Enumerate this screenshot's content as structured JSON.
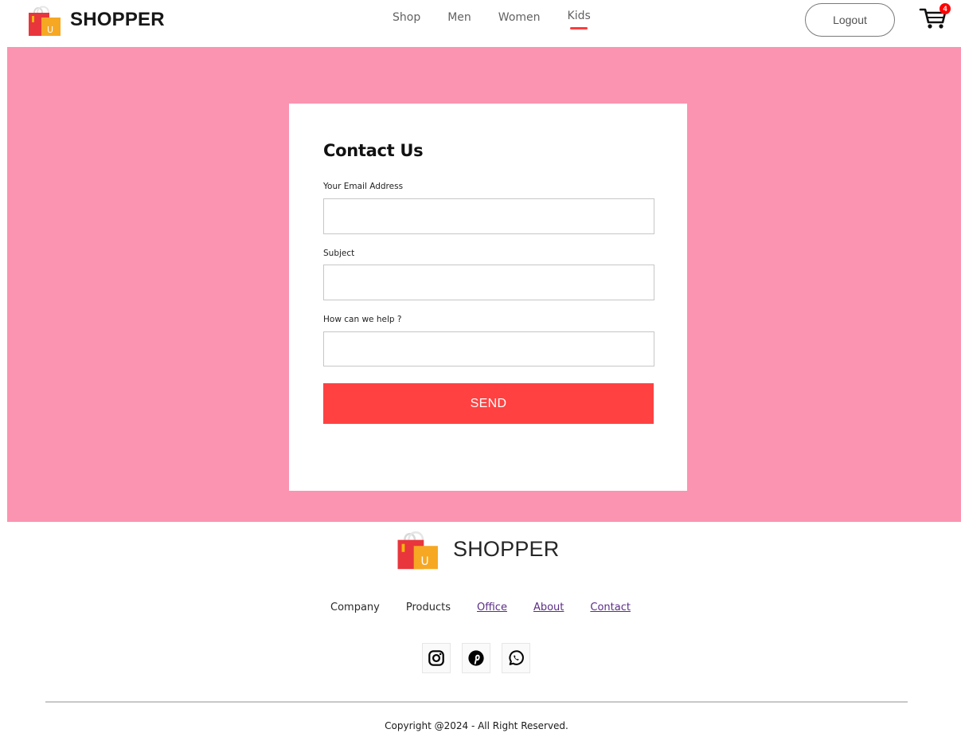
{
  "header": {
    "brand_name": "SHOPPER",
    "logo_letter": "U",
    "nav": [
      {
        "label": "Shop"
      },
      {
        "label": "Men"
      },
      {
        "label": "Women"
      },
      {
        "label": "Kids",
        "active": true
      }
    ],
    "logout_label": "Logout",
    "cart_count": "4"
  },
  "contact_form": {
    "title": "Contact Us",
    "email_label": "Your Email Address",
    "email_value": "",
    "subject_label": "Subject",
    "subject_value": "",
    "help_label": "How can we help ?",
    "help_value": "",
    "send_label": "SEND"
  },
  "footer": {
    "brand_name": "SHOPPER",
    "links": [
      {
        "label": "Company"
      },
      {
        "label": "Products"
      },
      {
        "label": "Office"
      },
      {
        "label": "About"
      },
      {
        "label": "Contact"
      }
    ],
    "social_icons": [
      "instagram-icon",
      "pinterest-icon",
      "whatsapp-icon"
    ],
    "copyright": "Copyright @2024 - All Right Reserved."
  },
  "colors": {
    "hero_bg": "#fb94b0",
    "accent": "#ff4141",
    "nav_underline": "#ff3b3b",
    "footer_link_visited": "#5b2d86"
  }
}
